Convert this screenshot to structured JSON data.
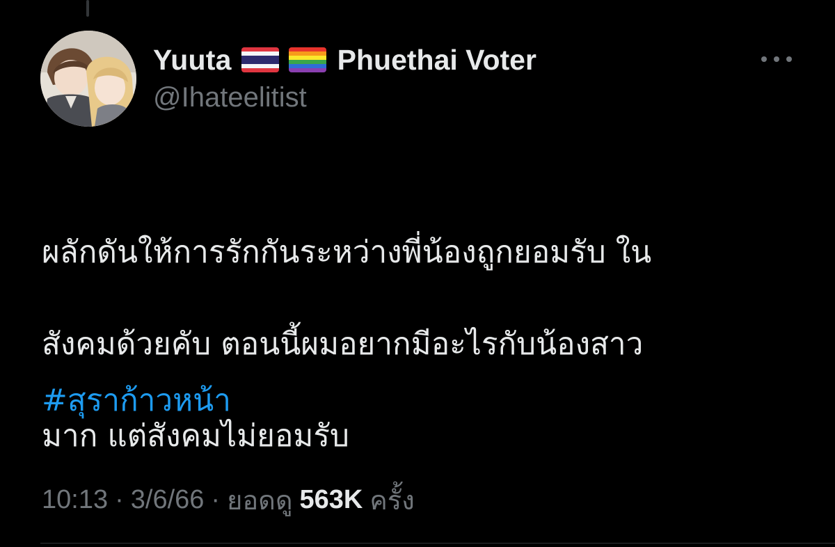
{
  "author": {
    "display_name": "Yuuta",
    "badges": [
      {
        "icon": "thailand-flag-icon"
      },
      {
        "icon": "rainbow-pride-flag-icon"
      }
    ],
    "name_suffix": "Phuethai Voter",
    "handle": "@Ihateelitist",
    "avatar": "anime-couple-avatar"
  },
  "tweet": {
    "lines": [
      "ผลักดันให้การรักกันระหว่างพี่น้องถูกยอมรับ ใน",
      "สังคมด้วยคับ ตอนนี้ผมอยากมีอะไรกับน้องสาว",
      "มาก แต่สังคมไม่ยอมรับ"
    ],
    "hashtag": "#สุราก้าวหน้า"
  },
  "meta": {
    "time": "10:13",
    "separator": "·",
    "date": "3/6/66",
    "views_label": "ยอดดู",
    "views_count": "563K",
    "views_suffix": "ครั้ง"
  },
  "icons": {
    "more": "more-horizontal-icon"
  },
  "colors": {
    "background": "#000000",
    "primary_text": "#e7e9ea",
    "secondary_text": "#71767b",
    "link": "#1d9bf0"
  }
}
